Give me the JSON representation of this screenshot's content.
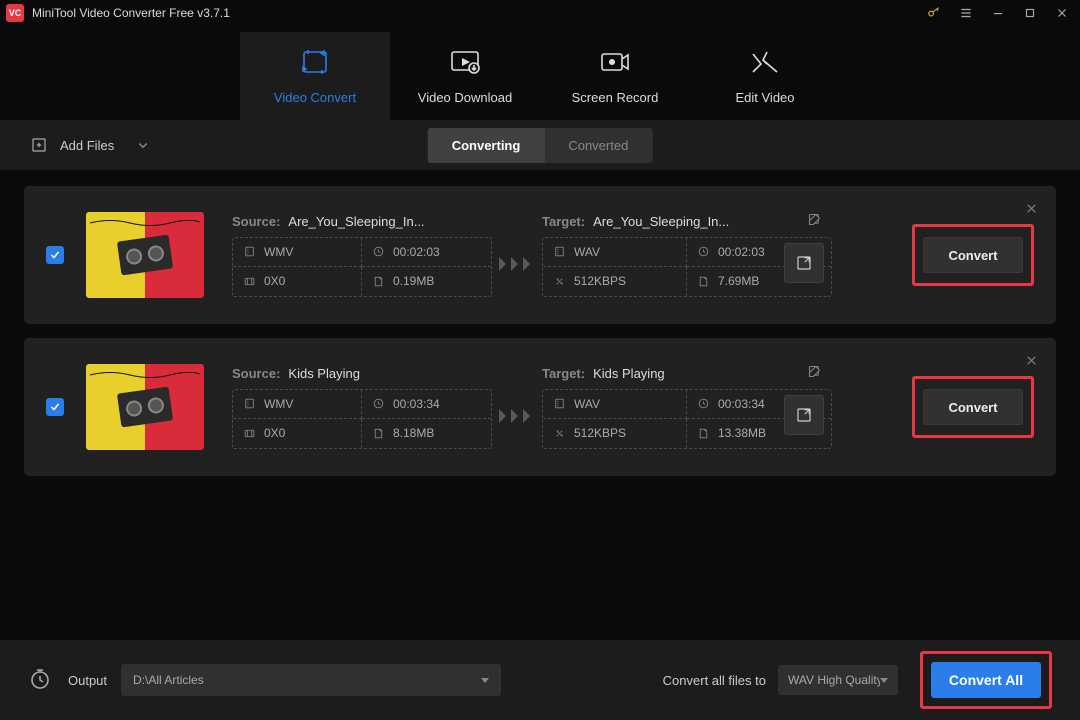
{
  "app": {
    "title": "MiniTool Video Converter Free v3.7.1"
  },
  "nav": {
    "convert": "Video Convert",
    "download": "Video Download",
    "record": "Screen Record",
    "edit": "Edit Video"
  },
  "toolbar": {
    "add": "Add Files",
    "converting": "Converting",
    "converted": "Converted"
  },
  "items": [
    {
      "source_label": "Source:",
      "source_name": "Are_You_Sleeping_In...",
      "src": {
        "fmt": "WMV",
        "dur": "00:02:03",
        "res": "0X0",
        "size": "0.19MB"
      },
      "target_label": "Target:",
      "target_name": "Are_You_Sleeping_In...",
      "tgt": {
        "fmt": "WAV",
        "dur": "00:02:03",
        "rate": "512KBPS",
        "size": "7.69MB"
      },
      "convert": "Convert",
      "thumb": [
        "#e9cf2b",
        "#d92b3a"
      ]
    },
    {
      "source_label": "Source:",
      "source_name": "Kids Playing",
      "src": {
        "fmt": "WMV",
        "dur": "00:03:34",
        "res": "0X0",
        "size": "8.18MB"
      },
      "target_label": "Target:",
      "target_name": "Kids Playing",
      "tgt": {
        "fmt": "WAV",
        "dur": "00:03:34",
        "rate": "512KBPS",
        "size": "13.38MB"
      },
      "convert": "Convert",
      "thumb": [
        "#e9cf2b",
        "#d92b3a"
      ]
    }
  ],
  "footer": {
    "output_label": "Output",
    "output_path": "D:\\All Articles",
    "convert_all_to": "Convert all files to",
    "format": "WAV High Quality",
    "convert_all": "Convert All"
  }
}
